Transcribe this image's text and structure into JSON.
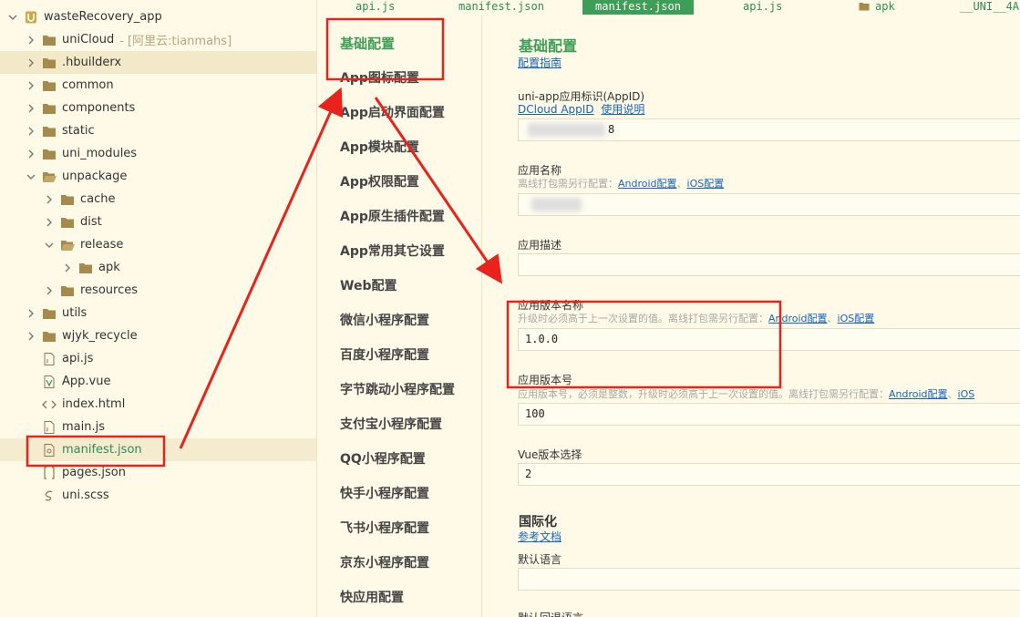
{
  "tree": {
    "root": "wasteRecovery_app",
    "unicloud": {
      "label": "uniCloud",
      "suffix": "- [阿里云:tianmahs]"
    },
    "items": [
      {
        "label": "uniCloud"
      },
      {
        "label": ".hbuilderx"
      },
      {
        "label": "common"
      },
      {
        "label": "components"
      },
      {
        "label": "static"
      },
      {
        "label": "uni_modules"
      },
      {
        "label": "unpackage"
      },
      {
        "label": "cache"
      },
      {
        "label": "dist"
      },
      {
        "label": "release"
      },
      {
        "label": "apk"
      },
      {
        "label": "resources"
      },
      {
        "label": "utils"
      },
      {
        "label": "wjyk_recycle"
      },
      {
        "label": "api.js"
      },
      {
        "label": "App.vue"
      },
      {
        "label": "index.html"
      },
      {
        "label": "main.js"
      },
      {
        "label": "manifest.json"
      },
      {
        "label": "pages.json"
      },
      {
        "label": "uni.scss"
      }
    ]
  },
  "tabs": [
    {
      "label": "api.js"
    },
    {
      "label": "manifest.json"
    },
    {
      "label": "manifest.json"
    },
    {
      "label": "api.js"
    },
    {
      "label": "apk"
    },
    {
      "label": "__UNI__4A"
    }
  ],
  "nav": [
    "基础配置",
    "App图标配置",
    "App启动界面配置",
    "App模块配置",
    "App权限配置",
    "App原生插件配置",
    "App常用其它设置",
    "Web配置",
    "微信小程序配置",
    "百度小程序配置",
    "字节跳动小程序配置",
    "支付宝小程序配置",
    "QQ小程序配置",
    "快手小程序配置",
    "飞书小程序配置",
    "京东小程序配置",
    "快应用配置"
  ],
  "form": {
    "title": "基础配置",
    "guide_link": "配置指南",
    "appid_label": "uni-app应用标识(AppID)",
    "appid_link1": "DCloud AppID",
    "appid_link2": "使用说明",
    "appid_value_tail": "8",
    "appname_label": "应用名称",
    "offline_hint": "离线打包需另行配置：",
    "android_link": "Android配置",
    "sep": "、",
    "ios_link": "iOS配置",
    "desc_label": "应用描述",
    "version_name_label": "应用版本名称",
    "version_name_hint": "升级时必须高于上一次设置的值。离线打包需另行配置：",
    "version_name_value": "1.0.0",
    "version_code_label": "应用版本号",
    "version_code_hint": "应用版本号，必须是整数，升级时必须高于上一次设置的值。离线打包需另行配置：",
    "ios_link_trunc": "iOS",
    "version_code_value": "100",
    "vue_label": "Vue版本选择",
    "vue_value": "2",
    "i18n_title": "国际化",
    "i18n_link": "参考文档",
    "default_lang_label": "默认语言",
    "fallback_lang_label": "默认回退语言"
  },
  "colors": {
    "accent": "#3e9e58",
    "link": "#1565c0",
    "annotation": "#e8231c",
    "background": "#fffae8"
  }
}
